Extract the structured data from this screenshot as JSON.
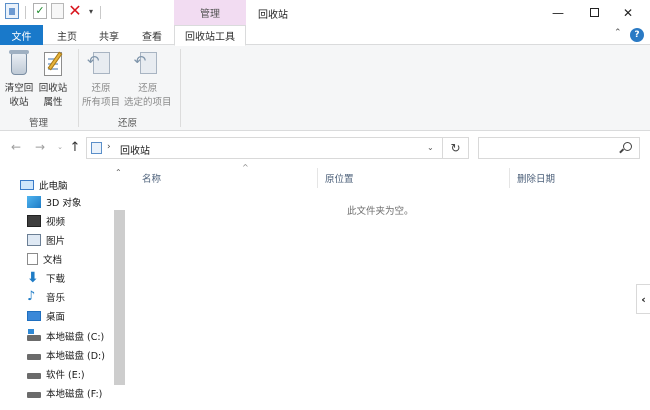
{
  "titlebar": {
    "context_header": "管理",
    "window_title": "回收站",
    "check_glyph": "✓",
    "delete_glyph": "✕",
    "dropdown_glyph": "▾",
    "minimize_glyph": "—",
    "close_glyph": "✕"
  },
  "tabs": {
    "file": "文件",
    "home": "主页",
    "share": "共享",
    "view": "查看",
    "tools": "回收站工具",
    "collapse_glyph": "⌃",
    "help_glyph": "?"
  },
  "ribbon": {
    "buttons": [
      {
        "line1": "清空回",
        "line2": "收站"
      },
      {
        "line1": "回收站",
        "line2": "属性"
      },
      {
        "line1": "还原",
        "line2": "所有项目"
      },
      {
        "line1": "还原",
        "line2": "选定的项目"
      }
    ],
    "groups": {
      "manage": "管理",
      "restore": "还原"
    }
  },
  "navbar": {
    "back_glyph": "←",
    "forward_glyph": "→",
    "dropdown_glyph": "⌄",
    "up_glyph": "↑",
    "path_sep": "›",
    "path": "回收站",
    "address_dropdown_glyph": "⌄",
    "refresh_glyph": "↻"
  },
  "sidebar": {
    "scroll_up_glyph": "⌃",
    "items": [
      {
        "label": "此电脑",
        "icon": "computer-icon"
      },
      {
        "label": "3D 对象",
        "icon": "3d-objects-icon"
      },
      {
        "label": "视频",
        "icon": "video-icon"
      },
      {
        "label": "图片",
        "icon": "picture-icon"
      },
      {
        "label": "文档",
        "icon": "document-icon"
      },
      {
        "label": "下载",
        "icon": "download-icon",
        "glyph": "⬇"
      },
      {
        "label": "音乐",
        "icon": "music-icon",
        "glyph": "♪"
      },
      {
        "label": "桌面",
        "icon": "desktop-icon"
      },
      {
        "label": "本地磁盘 (C:)",
        "icon": "system-drive-icon"
      },
      {
        "label": "本地磁盘 (D:)",
        "icon": "drive-icon"
      },
      {
        "label": "软件 (E:)",
        "icon": "drive-icon"
      },
      {
        "label": "本地磁盘 (F:)",
        "icon": "drive-icon"
      }
    ]
  },
  "content": {
    "columns": {
      "name": "名称",
      "original_location": "原位置",
      "date_deleted": "删除日期"
    },
    "sort_glyph": "^",
    "empty_message": "此文件夹为空。",
    "preview_toggle_glyph": "‹"
  },
  "colors": {
    "accent": "#1979ca",
    "context_tab": "#f2dcf2",
    "ribbon_bg": "#f5f6f7"
  }
}
